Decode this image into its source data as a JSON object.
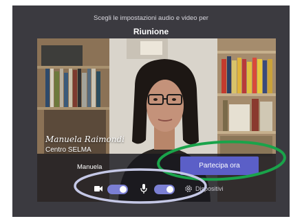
{
  "header": {
    "subtitle": "Scegli le impostazioni audio e video per",
    "title": "Riunione"
  },
  "preview": {
    "caption_name": "Manuela Raimondi",
    "caption_org": "Centro SELMA",
    "user_name": "Manuela"
  },
  "actions": {
    "join_label": "Partecipa ora"
  },
  "controls": {
    "camera_on": true,
    "mic_on": true,
    "devices_label": "Dispositivi"
  },
  "colors": {
    "window_bg": "#3b3a40",
    "accent": "#5b5fc7",
    "toggle_on": "#7b7fd4",
    "annotation_green": "#1aa34a",
    "annotation_lavender": "#c5c8e6"
  },
  "icons": {
    "camera": "camera-icon",
    "mic": "microphone-icon",
    "settings": "gear-icon"
  }
}
